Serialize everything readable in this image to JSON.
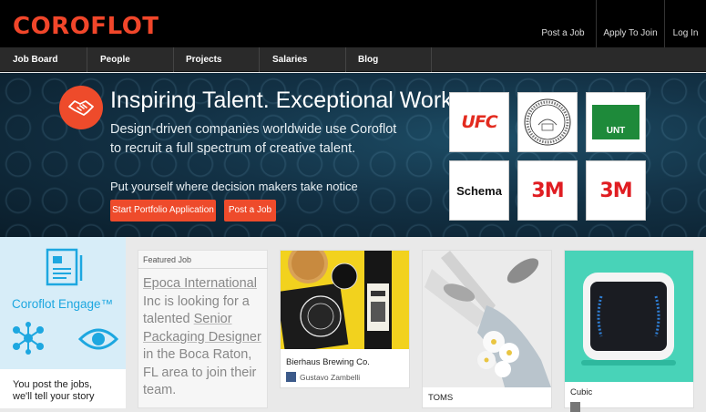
{
  "header": {
    "logo_text": "COROFLOT",
    "links": [
      {
        "label": "Post a Job"
      },
      {
        "label": "Apply To Join"
      },
      {
        "label": "Log In"
      }
    ]
  },
  "nav": {
    "items": [
      {
        "label": "Job Board"
      },
      {
        "label": "People"
      },
      {
        "label": "Projects"
      },
      {
        "label": "Salaries"
      },
      {
        "label": "Blog"
      }
    ]
  },
  "hero": {
    "title": "Inspiring Talent. Exceptional Work.",
    "subtitle_line1": "Design-driven companies worldwide use Coroflot",
    "subtitle_line2": "to recruit a full spectrum of creative talent.",
    "cta_text": "Put yourself where decision makers take notice",
    "primary_button": "Start Portfolio Application",
    "secondary_button": "Post a Job",
    "client_logos": [
      {
        "name": "UFC",
        "text": "UFC"
      },
      {
        "name": "Syracuse University",
        "text": ""
      },
      {
        "name": "UNT",
        "text": "UNT"
      },
      {
        "name": "Schema",
        "text": "Schema"
      },
      {
        "name": "3M",
        "text": "3M"
      },
      {
        "name": "3M",
        "text": "3M"
      }
    ],
    "accent_color": "#ee4b2b"
  },
  "engage": {
    "title": "Coroflot Engage™",
    "text_line1": "You post the jobs,",
    "text_line2": "we'll tell your story",
    "background_color": "#d7edf8",
    "accent_color": "#1da7e0"
  },
  "featured_job": {
    "label": "Featured Job",
    "text_parts": [
      "Epoca International",
      " Inc is looking for a talented ",
      "Senior Packaging Designer",
      " in the Boca Raton, FL area to join their team."
    ]
  },
  "cards": [
    {
      "title": "Bierhaus Brewing Co.",
      "author": "Gustavo Zambelli"
    },
    {
      "title": "TOMS",
      "author": ""
    },
    {
      "title": "Cubic",
      "author": ""
    }
  ]
}
